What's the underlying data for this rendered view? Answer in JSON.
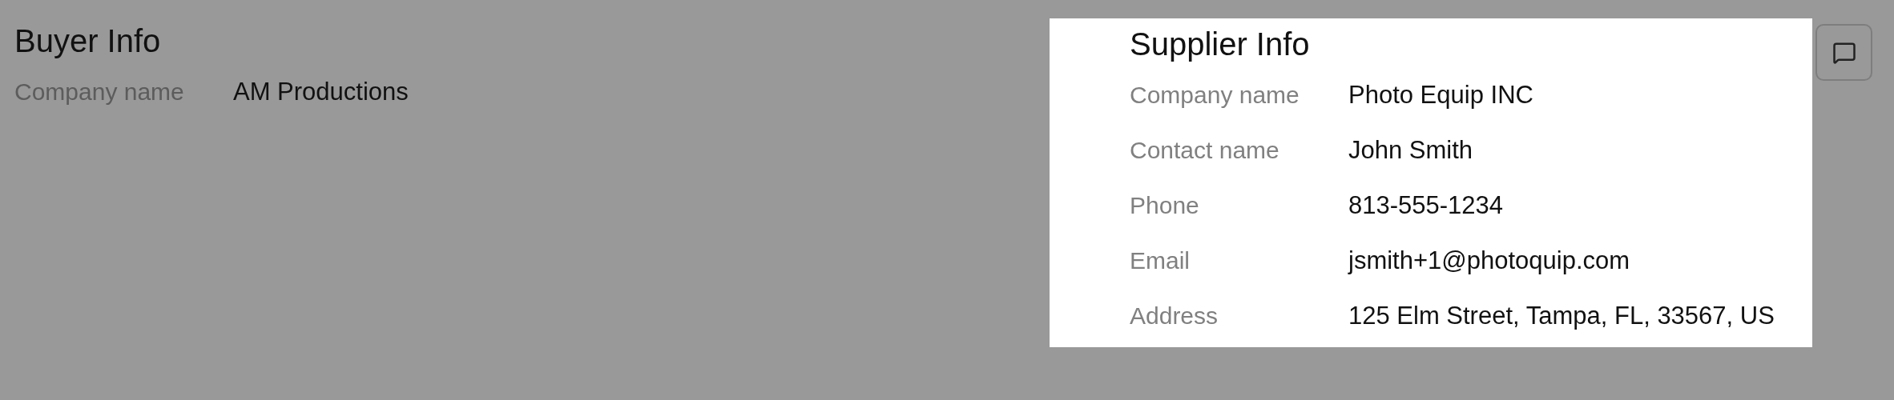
{
  "buyer": {
    "title": "Buyer Info",
    "fields": [
      {
        "label": "Company name",
        "value": "AM Productions"
      }
    ]
  },
  "supplier": {
    "title": "Supplier Info",
    "fields": [
      {
        "label": "Company name",
        "value": "Photo Equip INC"
      },
      {
        "label": "Contact name",
        "value": "John Smith"
      },
      {
        "label": "Phone",
        "value": "813-555-1234"
      },
      {
        "label": "Email",
        "value": "jsmith+1@photoquip.com"
      },
      {
        "label": "Address",
        "value": "125 Elm Street, Tampa, FL, 33567, US"
      }
    ]
  }
}
